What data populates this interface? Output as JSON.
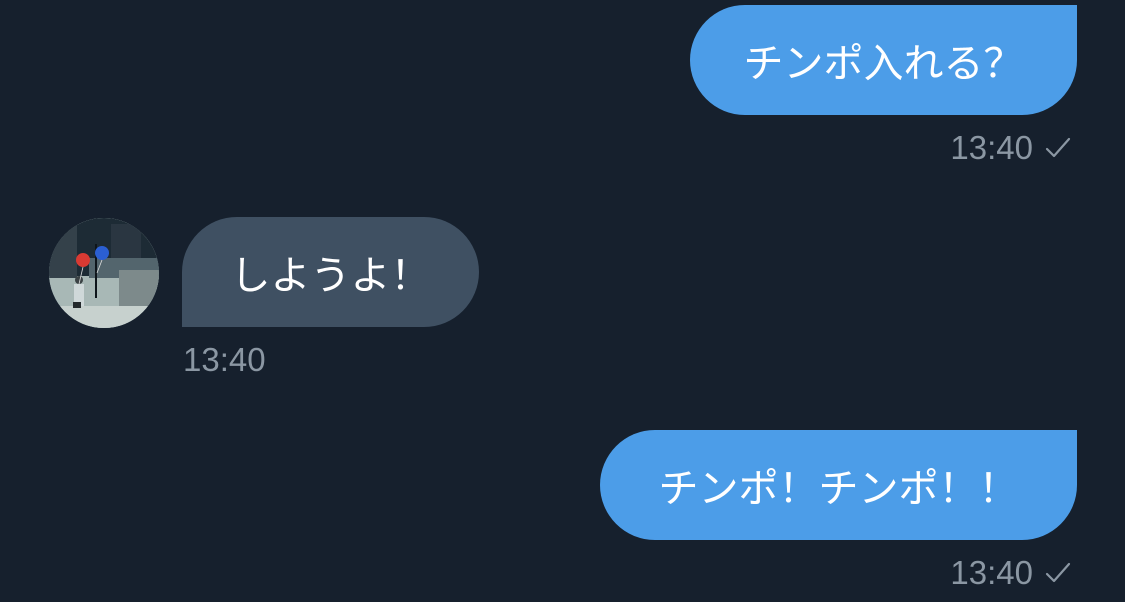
{
  "conversation": {
    "messages": [
      {
        "direction": "sent",
        "text": "チンポ入れる？",
        "time": "13:40",
        "status_icon": "sent-check-icon"
      },
      {
        "direction": "received",
        "text": "しようよ！",
        "time": "13:40",
        "avatar_icon": "contact-avatar"
      },
      {
        "direction": "sent",
        "text": "チンポ！チンポ！！",
        "time": "13:40",
        "status_icon": "sent-check-icon"
      }
    ]
  },
  "colors": {
    "background": "#16202d",
    "sent_bubble": "#4c9de8",
    "received_bubble": "#3f5062",
    "timestamp": "#8b97a3",
    "message_text": "#ffffff"
  }
}
